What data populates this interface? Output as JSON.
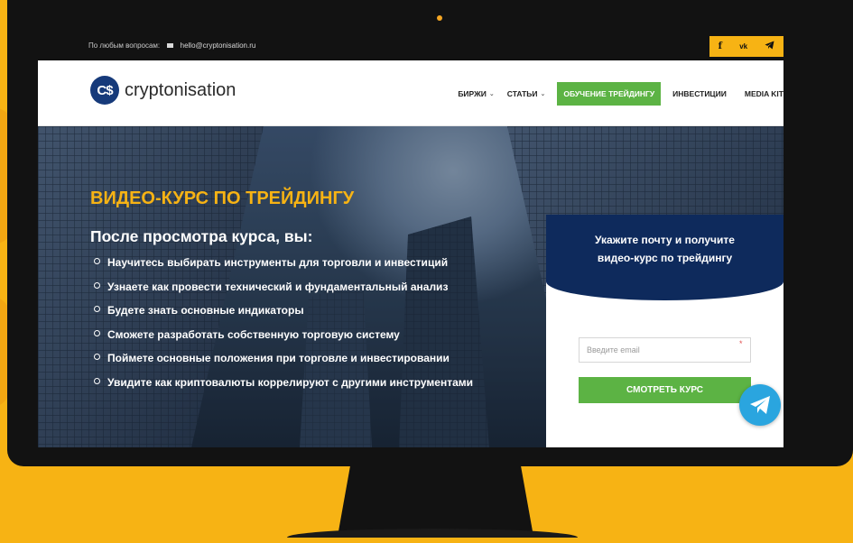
{
  "topbar": {
    "contact_label": "По любым вопросам:",
    "email": "hello@cryptonisation.ru"
  },
  "socials": [
    {
      "icon": "facebook-icon",
      "glyph": "f"
    },
    {
      "icon": "vk-icon",
      "glyph": "vk"
    },
    {
      "icon": "telegram-icon",
      "glyph": "telegram"
    }
  ],
  "logo": {
    "mark": "C$",
    "text": "cryptonisation"
  },
  "nav": {
    "items": [
      {
        "label": "БИРЖИ",
        "has_dropdown": true
      },
      {
        "label": "СТАТЬИ",
        "has_dropdown": true
      },
      {
        "label": "ОБУЧЕНИЕ ТРЕЙДИНГУ",
        "active": true
      },
      {
        "label": "ИНВЕСТИЦИИ"
      },
      {
        "label": "MEDIA KIT"
      }
    ]
  },
  "hero": {
    "title": "ВИДЕО-КУРС ПО ТРЕЙДИНГУ",
    "subtitle": "После просмотра курса, вы:",
    "benefits": [
      "Научитесь выбирать инструменты для торговли и инвестиций",
      "Узнаете как провести технический и фундаментальный анализ",
      "Будете знать основные индикаторы",
      "Сможете разработать собственную торговую систему",
      "Поймете основные положения при торговле и инвестировании",
      "Увидите как криптовалюты коррелируют с другими инструментами"
    ]
  },
  "form": {
    "heading_line1": "Укажите почту и получите",
    "heading_line2": "видео-курс по трейдингу",
    "email_placeholder": "Введите email",
    "required_mark": "*",
    "submit_label": "СМОТРЕТЬ КУРС"
  },
  "colors": {
    "background": "#f7b314",
    "accent_green": "#5cb344",
    "navy": "#0e2a5c",
    "title_orange": "#f7b314",
    "telegram_blue": "#2aa5df"
  }
}
